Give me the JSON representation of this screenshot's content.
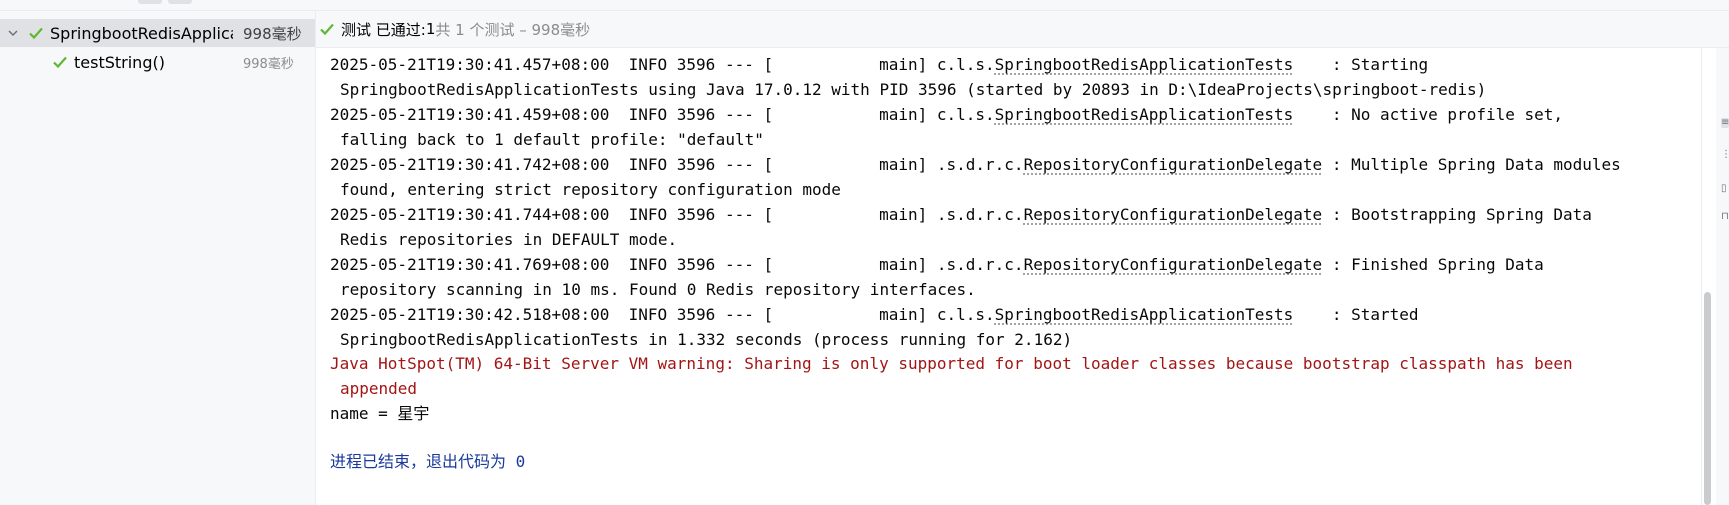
{
  "tree": {
    "root": {
      "label": "SpringbootRedisApplicati",
      "time": "998毫秒"
    },
    "child": {
      "label": "testString()",
      "time": "998毫秒"
    }
  },
  "status": {
    "label": "测试 已通过: ",
    "count": "1",
    "summary": "共 1 个测试 – 998毫秒"
  },
  "console": {
    "lines": [
      {
        "pre": "2025-05-21T19:30:41.457+08:00  INFO 3596 --- [           main] c.l.s.",
        "link": "SpringbootRedisApplicationTests",
        "post": "    : Starting"
      },
      {
        "pre": "SpringbootRedisApplicationTests using Java 17.0.12 with PID 3596 (started by 20893 in D:\\IdeaProjects\\springboot-redis)"
      },
      {
        "pre": "2025-05-21T19:30:41.459+08:00  INFO 3596 --- [           main] c.l.s.",
        "link": "SpringbootRedisApplicationTests",
        "post": "    : No active profile set,"
      },
      {
        "pre": "falling back to 1 default profile: \"default\""
      },
      {
        "pre": "2025-05-21T19:30:41.742+08:00  INFO 3596 --- [           main] .s.d.r.c.",
        "link": "RepositoryConfigurationDelegate",
        "post": " : Multiple Spring Data modules"
      },
      {
        "pre": "found, entering strict repository configuration mode"
      },
      {
        "pre": "2025-05-21T19:30:41.744+08:00  INFO 3596 --- [           main] .s.d.r.c.",
        "link": "RepositoryConfigurationDelegate",
        "post": " : Bootstrapping Spring Data"
      },
      {
        "pre": "Redis repositories in DEFAULT mode."
      },
      {
        "pre": "2025-05-21T19:30:41.769+08:00  INFO 3596 --- [           main] .s.d.r.c.",
        "link": "RepositoryConfigurationDelegate",
        "post": " : Finished Spring Data"
      },
      {
        "pre": "repository scanning in 10 ms. Found 0 Redis repository interfaces."
      },
      {
        "pre": "2025-05-21T19:30:42.518+08:00  INFO 3596 --- [           main] c.l.s.",
        "link": "SpringbootRedisApplicationTests",
        "post": "    : Started"
      },
      {
        "pre": "SpringbootRedisApplicationTests in 1.332 seconds (process running for 2.162)"
      },
      {
        "pre": "Java HotSpot(TM) 64-Bit Server VM warning: Sharing is only supported for boot loader classes because bootstrap classpath has been"
      },
      {
        "pre": "appended"
      },
      {
        "pre": "name = 星宇"
      },
      {
        "pre": "进程已结束，退出代码为 0"
      }
    ]
  },
  "colors": {
    "pass": "#5fb832",
    "error": "#a31515",
    "exit": "#1a3a9c"
  }
}
